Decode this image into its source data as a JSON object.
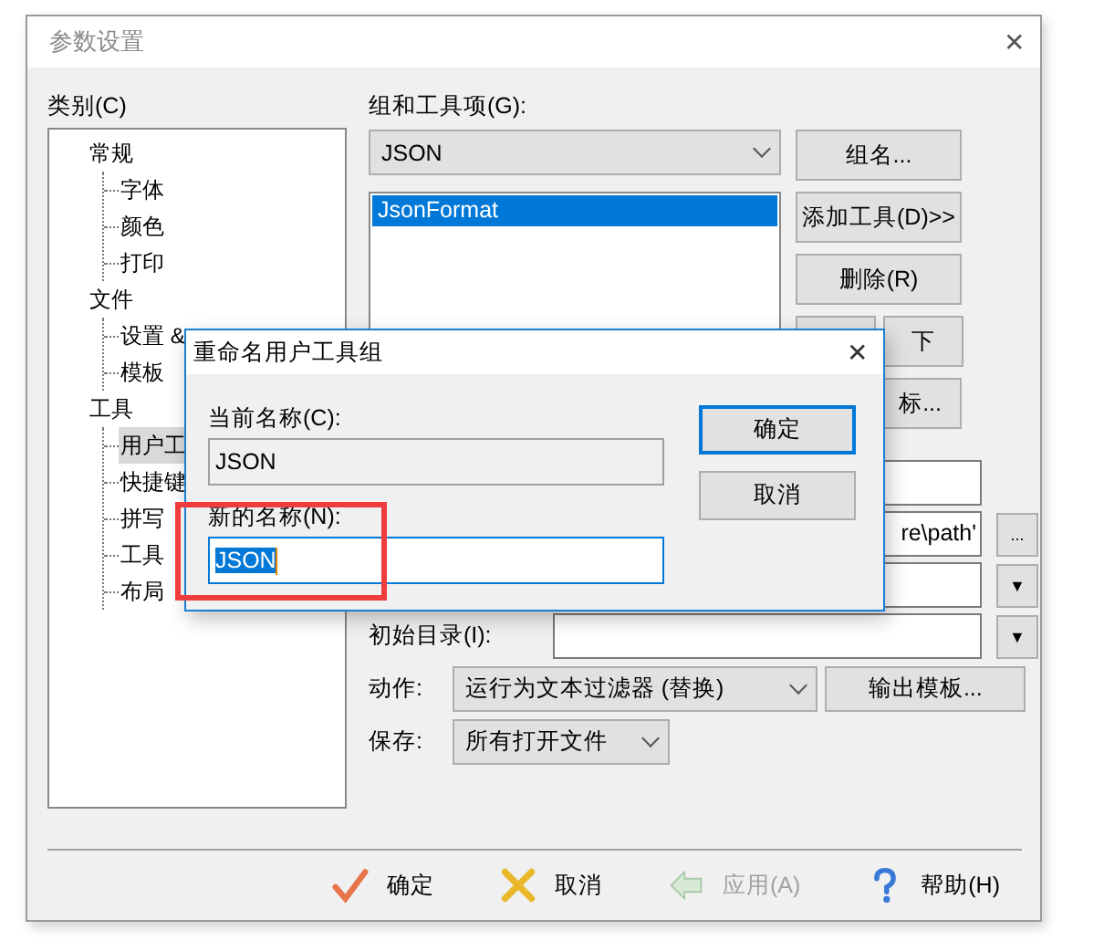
{
  "window": {
    "title": "参数设置",
    "close": "✕"
  },
  "category_label": "类别(C)",
  "tree": [
    {
      "label": "常规",
      "selected": false,
      "children": [
        {
          "label": "字体",
          "selected": false
        },
        {
          "label": "颜色",
          "selected": false
        },
        {
          "label": "打印",
          "selected": false
        }
      ]
    },
    {
      "label": "文件",
      "selected": false,
      "children": [
        {
          "label": "设置 &",
          "selected": false
        },
        {
          "label": "模板",
          "selected": false
        }
      ]
    },
    {
      "label": "工具",
      "selected": false,
      "children": [
        {
          "label": "用户工",
          "selected": true
        },
        {
          "label": "快捷键",
          "selected": false
        },
        {
          "label": "拼写",
          "selected": false
        },
        {
          "label": "工具",
          "selected": false
        },
        {
          "label": "布局",
          "selected": false
        }
      ]
    }
  ],
  "group_label": "组和工具项(G):",
  "group_combo": {
    "value": "JSON"
  },
  "tool_list": [
    {
      "label": "JsonFormat",
      "selected": true
    }
  ],
  "side_buttons": {
    "rename": "组名...",
    "add": "添加工具(D)>>",
    "delete": "删除(R)",
    "down": "下",
    "icon": "标..."
  },
  "fields": [
    {
      "kind": "plain"
    },
    {
      "kind": "browse",
      "value": "re\\path'",
      "button": "..."
    },
    {
      "kind": "dropdown",
      "button": "▼"
    }
  ],
  "start_dir": {
    "label": "初始目录(I):",
    "button": "▼"
  },
  "action": {
    "label": "动作:",
    "value": "运行为文本过滤器 (替换)",
    "button": "输出模板..."
  },
  "save": {
    "label": "保存:",
    "value": "所有打开文件"
  },
  "footer_buttons": [
    {
      "kind": "ok",
      "label": "确定",
      "disabled": false
    },
    {
      "kind": "cancel",
      "label": "取消",
      "disabled": false
    },
    {
      "kind": "apply",
      "label": "应用(A)",
      "disabled": true
    },
    {
      "kind": "help",
      "label": "帮助(H)",
      "disabled": false
    }
  ],
  "dialog": {
    "title": "重命名用户工具组",
    "close": "✕",
    "current_label": "当前名称(C):",
    "current_value": "JSON",
    "new_label": "新的名称(N):",
    "new_value": "JSON",
    "ok": "确定",
    "cancel": "取消"
  },
  "annotation_box": true
}
